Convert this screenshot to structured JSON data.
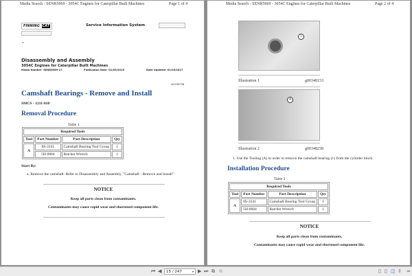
{
  "header_title": "Media Search - SENR5069 - 3054C Engines for Caterpillar Built Machines",
  "page1": {
    "page_label": "Page 1 of 4",
    "logo": "FINNING CAT",
    "sis_title": "Service Information System",
    "back": "«",
    "doc_title": "Disassembly and Assembly",
    "doc_subtitle": "3054C Engines for Caterpillar Built Machines",
    "media_number": "Media Number -SENR5069-17",
    "pub_date": "Publication Date -01/05/2015",
    "updated": "Date Updated -01/05/2017",
    "doc_id": "i02299758",
    "heading": "Camshaft Bearings - Remove and Install",
    "smcs": "SMCS - 1211-010",
    "section": "Removal Procedure",
    "table_caption": "Table 1",
    "start_by": "Start By:",
    "step_a": "a.  Remove the camshaft. Refer to Disassembly and Assembly, \"Camshaft - Remove and Install\"."
  },
  "page2": {
    "page_label": "Page 2 of 4",
    "illus1": "Illustration 1",
    "illus1_id": "g00348153",
    "callout1": "1",
    "illus2": "Illustration 2",
    "illus2_id": "g00348238",
    "callout2": "A",
    "step1": "1.  Use the Tooling (A) in order to remove the camshaft bearing (1) from the cylinder block.",
    "section": "Installation Procedure",
    "table_caption": "Table 2"
  },
  "table": {
    "title": "Required Tools",
    "headers": [
      "Tool",
      "Part Number",
      "Part Description",
      "Qty"
    ],
    "tool": "A",
    "rows": [
      {
        "part": "8S-2241",
        "desc": "Camshaft Bearing Tool Group",
        "qty": "1"
      },
      {
        "part": "5H-0684",
        "desc": "Ratchet Wrench",
        "qty": "1"
      }
    ]
  },
  "notice": {
    "title": "NOTICE",
    "line1": "Keep all parts clean from contaminants.",
    "line2": "Contaminants may cause rapid wear and shortened component life."
  },
  "toolbar": {
    "page_value": "15 / 247"
  }
}
